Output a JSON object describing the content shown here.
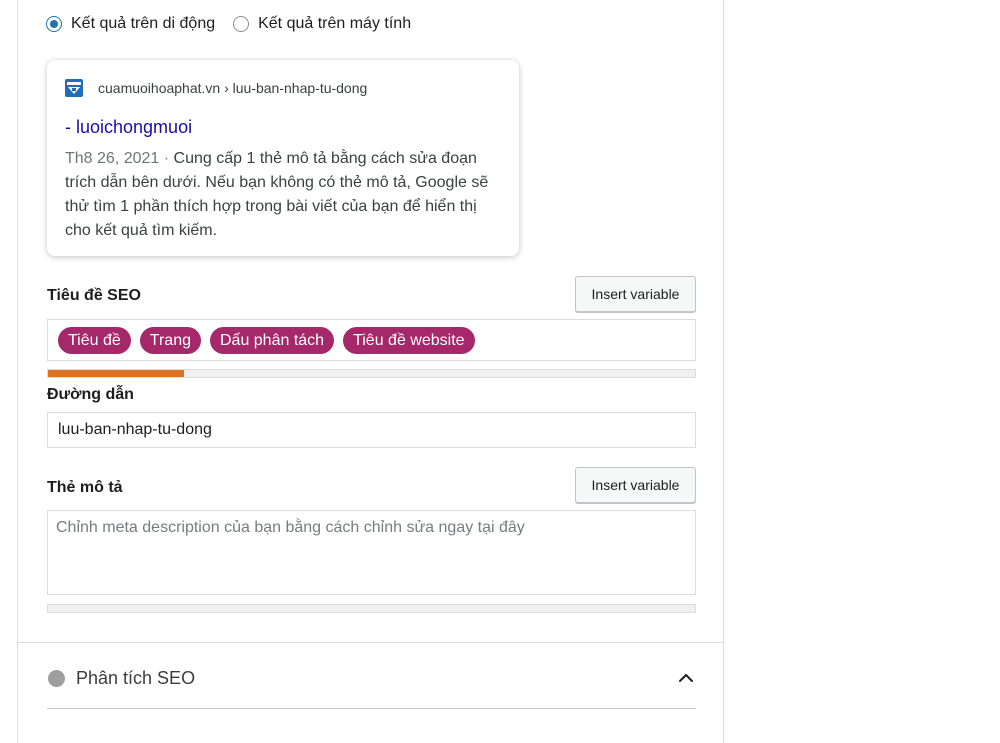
{
  "preview_mode": {
    "mobile_label": "Kết quả trên di động",
    "desktop_label": "Kết quả trên máy tính",
    "selected": "mobile"
  },
  "serp_preview": {
    "breadcrumb": "cuamuoihoaphat.vn › luu-ban-nhap-tu-dong",
    "title": "- luoichongmuoi",
    "date": "Th8 26, 2021 ·",
    "description": "Cung cấp 1 thẻ mô tả bằng cách sửa đoạn trích dẫn bên dưới. Nếu bạn không có thẻ mô tả, Google sẽ thử tìm 1 phần thích hợp trong bài viết của bạn để hiển thị cho kết quả tìm kiếm."
  },
  "seo_title": {
    "label": "Tiêu đề SEO",
    "insert_label": "Insert variable",
    "chips": [
      "Tiêu đề",
      "Trang",
      "Dấu phân tách",
      "Tiêu đề website"
    ],
    "progress_percent": 21
  },
  "slug": {
    "label": "Đường dẫn",
    "value": "luu-ban-nhap-tu-dong"
  },
  "meta_description": {
    "label": "Thẻ mô tả",
    "insert_label": "Insert variable",
    "placeholder": "Chỉnh meta description của bạn bằng cách chỉnh sửa ngay tại đây",
    "progress_percent": 0
  },
  "analysis": {
    "title": "Phân tích SEO",
    "expanded": true
  },
  "colors": {
    "accent": "#2271b1",
    "chip": "#a4286a",
    "progress": "#dd7321",
    "link": "#1a0dab"
  }
}
